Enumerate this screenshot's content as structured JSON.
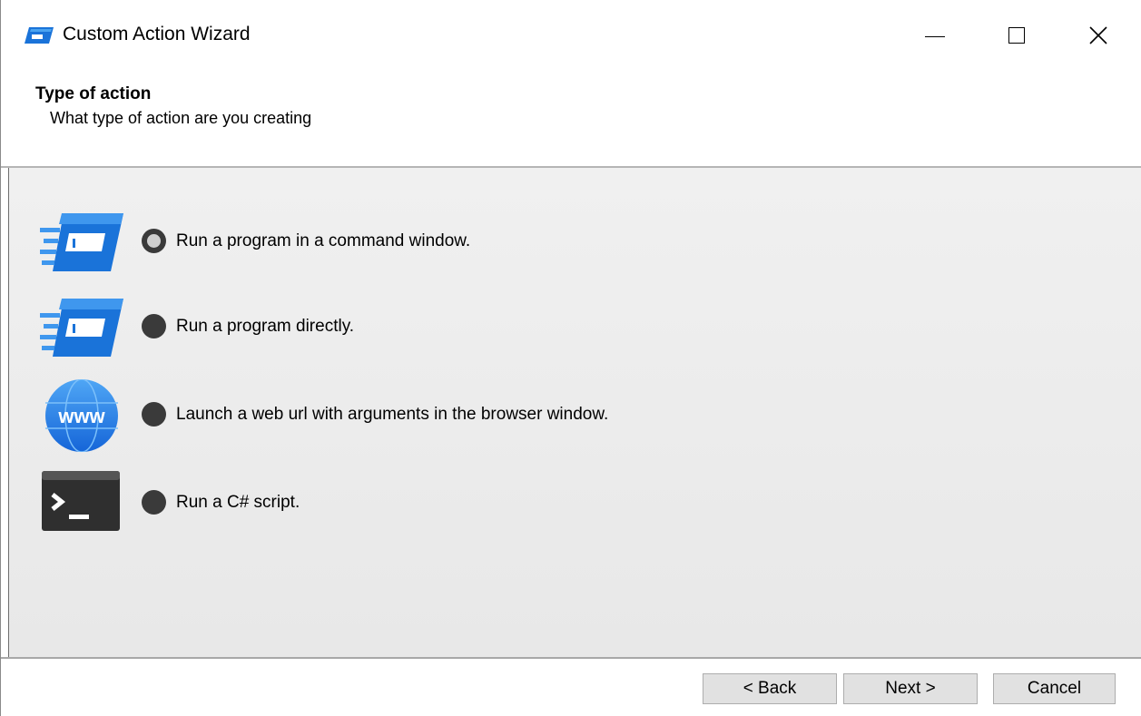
{
  "window": {
    "title": "Custom Action Wizard",
    "app_icon": "custom-action-app-icon"
  },
  "header": {
    "title": "Type of action",
    "subtitle": "What type of action are you creating"
  },
  "options": [
    {
      "label": "Run a program in a command window.",
      "icon": "command-window-icon",
      "selected": true
    },
    {
      "label": "Run a program directly.",
      "icon": "program-icon",
      "selected": false
    },
    {
      "label": "Launch a web url with arguments in the browser window.",
      "icon": "www-globe-icon",
      "selected": false
    },
    {
      "label": "Run a C# script.",
      "icon": "terminal-icon",
      "selected": false
    }
  ],
  "www_icon_text": "www",
  "buttons": {
    "back": "< Back",
    "next": "Next >",
    "cancel": "Cancel"
  },
  "colors": {
    "accent_blue": "#1a73d9",
    "radio_dark": "#3a3a3a",
    "button_face": "#e1e1e1"
  }
}
